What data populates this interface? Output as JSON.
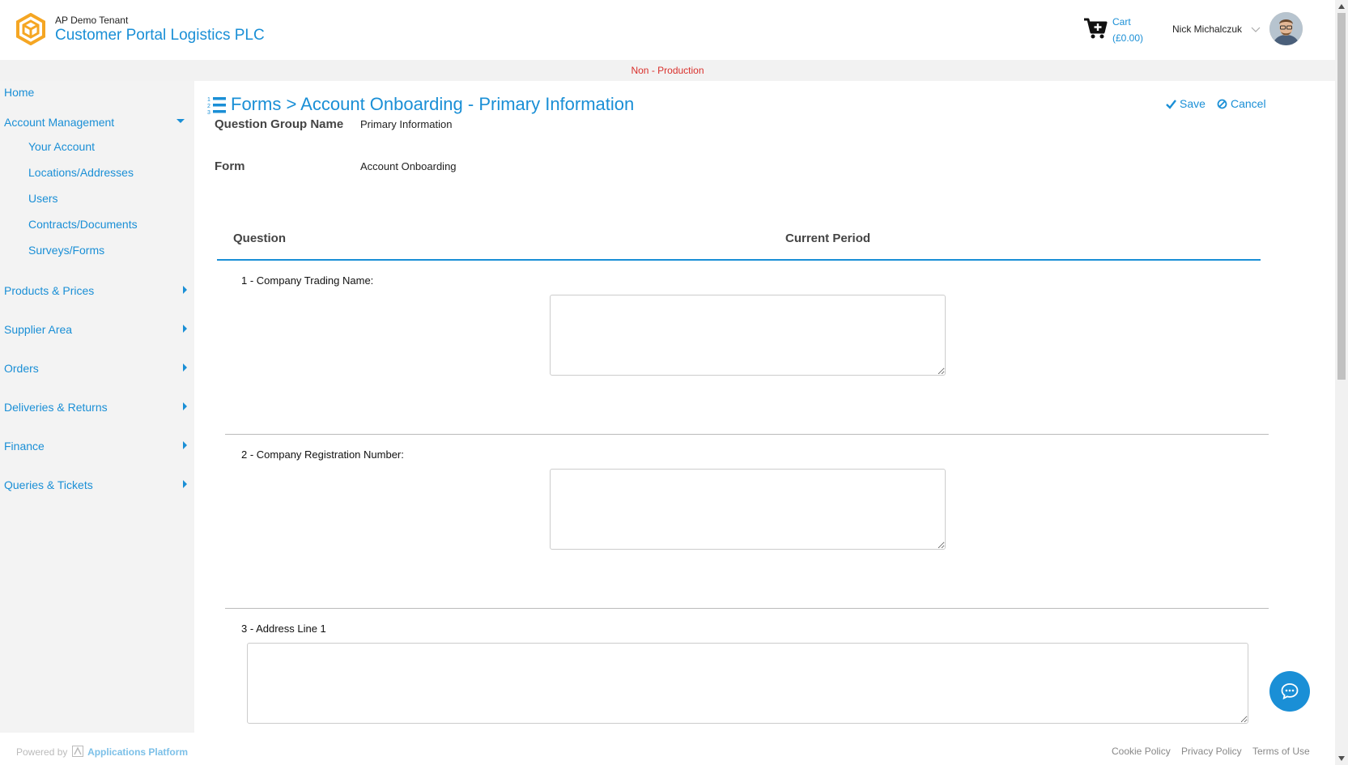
{
  "header": {
    "tenant": "AP Demo Tenant",
    "portal_title": "Customer Portal Logistics PLC",
    "cart_label": "Cart",
    "cart_total": "(£0.00)",
    "user_name": "Nick Michalczuk"
  },
  "environment_banner": "Non - Production",
  "sidebar": {
    "home": "Home",
    "account_management": "Account Management",
    "account_sub": [
      "Your Account",
      "Locations/Addresses",
      "Users",
      "Contracts/Documents",
      "Surveys/Forms"
    ],
    "sections": [
      "Products & Prices",
      "Supplier Area",
      "Orders",
      "Deliveries & Returns",
      "Finance",
      "Queries & Tickets"
    ]
  },
  "page": {
    "title": "Forms > Account Onboarding - Primary Information",
    "save_label": "Save",
    "cancel_label": "Cancel",
    "question_group_label": "Question Group Name",
    "question_group_value": "Primary Information",
    "form_label": "Form",
    "form_value": "Account Onboarding"
  },
  "table": {
    "col_question": "Question",
    "col_current_period": "Current Period",
    "questions": [
      {
        "label": "1 - Company Trading Name:",
        "value": ""
      },
      {
        "label": "2 - Company Registration Number:",
        "value": ""
      },
      {
        "label": "3 - Address Line 1",
        "value": ""
      }
    ]
  },
  "footer": {
    "powered_by": "Powered by",
    "platform": "Applications Platform",
    "links": [
      "Cookie Policy",
      "Privacy Policy",
      "Terms of Use"
    ]
  },
  "colors": {
    "accent": "#1a8fd6",
    "logo": "#f5a623",
    "environment": "#d9302c"
  }
}
